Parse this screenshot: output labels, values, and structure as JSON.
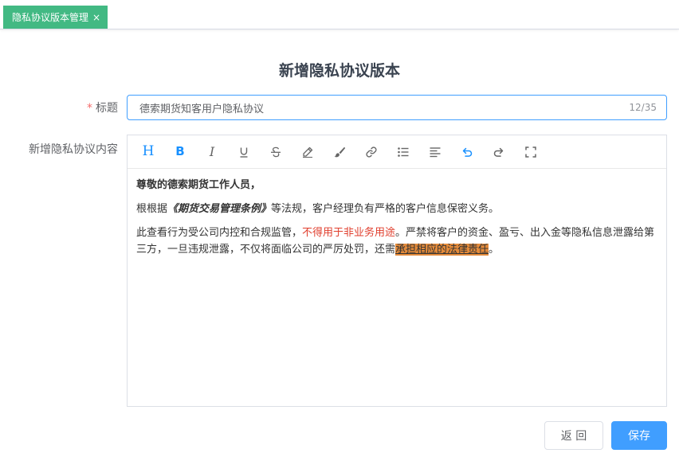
{
  "tab": {
    "label": "隐私协议版本管理",
    "close": "×"
  },
  "page": {
    "title": "新增隐私协议版本"
  },
  "form": {
    "title_label": "标题",
    "required_mark": "*",
    "title_value": "德索期货知客用户隐私协议",
    "title_count": "12/35",
    "content_label": "新增隐私协议内容"
  },
  "toolbar": {
    "items": [
      "heading",
      "bold",
      "italic",
      "underline",
      "strikethrough",
      "pen",
      "brush",
      "link",
      "list",
      "align",
      "undo",
      "redo",
      "fullscreen"
    ],
    "heading_glyph": "H",
    "bold_glyph": "B",
    "italic_glyph": "I"
  },
  "content": {
    "greeting": "尊敬的德索期货工作人员，",
    "p2_prefix": "根根据",
    "p2_emphasis": "《期货交易管理条例》",
    "p2_suffix": "等法规，客户经理负有严格的客户信息保密义务。",
    "p3_a": "此查看行为受公司内控和合规监管，",
    "p3_red": "不得用于非业务用途",
    "p3_b": "。严禁将客户的资金、盈亏、出入金等隐私信息泄露给第三方，一旦违规泄露，不仅将面临公司的严厉处罚，还需",
    "p3_hl": "承担相应的法律责任",
    "p3_end": "。"
  },
  "buttons": {
    "back": "返 回",
    "save": "保存"
  },
  "colors": {
    "tab": "#42b983",
    "primary": "#409eff",
    "red_text": "#e03e2d",
    "highlight": "#e48b3b"
  }
}
